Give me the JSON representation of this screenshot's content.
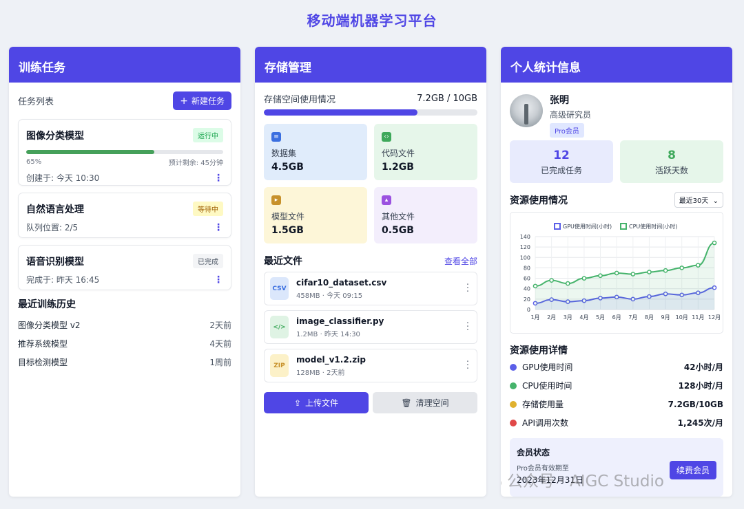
{
  "page": {
    "title": "移动端机器学习平台"
  },
  "training": {
    "title": "训练任务",
    "list_label": "任务列表",
    "new_button": "新建任务",
    "tasks": [
      {
        "name": "图像分类模型",
        "status": "运行中",
        "progress_text": "65%",
        "progress": 0.65,
        "remaining": "预计剩余: 45分钟",
        "footer": "创建于: 今天 10:30"
      },
      {
        "name": "自然语言处理",
        "status": "等待中",
        "footer": "队列位置: 2/5"
      },
      {
        "name": "语音识别模型",
        "status": "已完成",
        "footer": "完成于: 昨天 16:45"
      }
    ],
    "history_title": "最近训练历史",
    "history": [
      {
        "name": "图像分类模型 v2",
        "time": "2天前"
      },
      {
        "name": "推荐系统模型",
        "time": "4天前"
      },
      {
        "name": "目标检测模型",
        "time": "1周前"
      }
    ]
  },
  "storage": {
    "title": "存储管理",
    "usage_label": "存储空间使用情况",
    "usage_text": "7.2GB / 10GB",
    "usage_fraction": 0.72,
    "tiles": [
      {
        "label": "数据集",
        "value": "4.5GB",
        "icon": "database-icon",
        "bg": "#e0ecfb",
        "color": "#3b6fe0"
      },
      {
        "label": "代码文件",
        "value": "1.2GB",
        "icon": "code-file-icon",
        "bg": "#e6f6ea",
        "color": "#3da85a"
      },
      {
        "label": "模型文件",
        "value": "1.5GB",
        "icon": "model-file-icon",
        "bg": "#fdf6d8",
        "color": "#c7912b"
      },
      {
        "label": "其他文件",
        "value": "0.5GB",
        "icon": "image-file-icon",
        "bg": "#f3eefc",
        "color": "#9b51e0"
      }
    ],
    "recent_title": "最近文件",
    "view_all": "查看全部",
    "files": [
      {
        "name": "cifar10_dataset.csv",
        "meta": "458MB · 今天 09:15",
        "badge": "CSV",
        "bg": "#dbe7fb",
        "color": "#3b6fe0"
      },
      {
        "name": "image_classifier.py",
        "meta": "1.2MB · 昨天 14:30",
        "badge": "</>",
        "bg": "#dff3e4",
        "color": "#3da85a"
      },
      {
        "name": "model_v1.2.zip",
        "meta": "128MB · 2天前",
        "badge": "ZIP",
        "bg": "#fcf1c8",
        "color": "#c7912b"
      }
    ],
    "upload_button": "上传文件",
    "clean_button": "清理空间"
  },
  "profile": {
    "title": "个人统计信息",
    "name": "张明",
    "role": "高级研究员",
    "member_badge": "Pro会员",
    "completed_num": "12",
    "completed_label": "已完成任务",
    "active_num": "8",
    "active_label": "活跃天数",
    "resource_title": "资源使用情况",
    "range_select": "最近30天",
    "detail_title": "资源使用详情",
    "details": [
      {
        "label": "GPU使用时间",
        "value": "42小时/月",
        "color": "#5b5fe8"
      },
      {
        "label": "CPU使用时间",
        "value": "128小时/月",
        "color": "#45b36b"
      },
      {
        "label": "存储使用量",
        "value": "7.2GB/10GB",
        "color": "#e0b12e"
      },
      {
        "label": "API调用次数",
        "value": "1,245次/月",
        "color": "#e04848"
      }
    ],
    "membership_title": "会员状态",
    "membership_sub": "Pro会员有效期至",
    "membership_date": "2023年12月31日",
    "renew_button": "续费会员",
    "watermark": "公众号 · AIGC Studio"
  },
  "chart_data": {
    "type": "line",
    "categories": [
      "1月",
      "2月",
      "3月",
      "4月",
      "5月",
      "6月",
      "7月",
      "8月",
      "9月",
      "10月",
      "11月",
      "12月"
    ],
    "series": [
      {
        "name": "GPU使用时间(小时)",
        "values": [
          12,
          19,
          15,
          17,
          22,
          24,
          20,
          25,
          30,
          28,
          32,
          42
        ],
        "color": "#5b5fe8"
      },
      {
        "name": "CPU使用时间(小时)",
        "values": [
          45,
          56,
          50,
          60,
          65,
          70,
          68,
          72,
          75,
          80,
          85,
          128
        ],
        "color": "#45b36b"
      }
    ],
    "ylim": [
      0,
      140
    ],
    "yticks": [
      "0",
      "20",
      "40",
      "60",
      "80",
      "100",
      "120",
      "140"
    ],
    "grid": true,
    "legend": "top"
  }
}
